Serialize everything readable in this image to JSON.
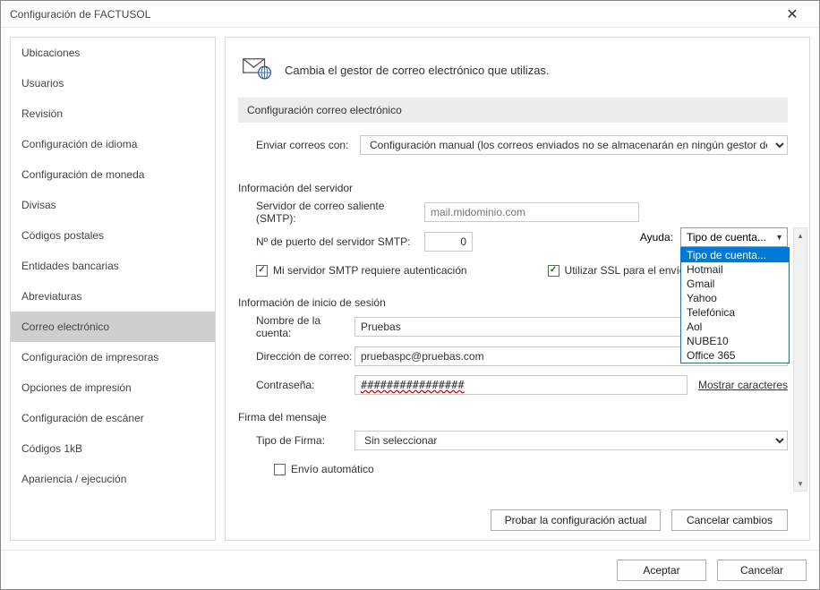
{
  "window": {
    "title": "Configuración de FACTUSOL"
  },
  "sidebar": {
    "items": [
      {
        "label": "Ubicaciones"
      },
      {
        "label": "Usuarios"
      },
      {
        "label": "Revisión"
      },
      {
        "label": "Configuración de idioma"
      },
      {
        "label": "Configuración de moneda"
      },
      {
        "label": "Divisas"
      },
      {
        "label": "Códigos postales"
      },
      {
        "label": "Entidades bancarias"
      },
      {
        "label": "Abreviaturas"
      },
      {
        "label": "Correo electrónico",
        "selected": true
      },
      {
        "label": "Configuración de impresoras"
      },
      {
        "label": "Opciones de impresión"
      },
      {
        "label": "Configuración de escáner"
      },
      {
        "label": "Códigos 1kB"
      },
      {
        "label": "Apariencia / ejecución"
      }
    ]
  },
  "main": {
    "heading": "Cambia el gestor de correo electrónico que utilizas.",
    "section_title": "Configuración correo electrónico",
    "send_with_label": "Enviar correos con:",
    "send_with_value": "Configuración manual (los correos enviados no se almacenarán en ningún gestor de correo)",
    "server_info_heading": "Información del servidor",
    "help_label": "Ayuda:",
    "account_type_label": "Tipo de cuenta...",
    "account_type_options": [
      "Tipo de cuenta...",
      "Hotmail",
      "Gmail",
      "Yahoo",
      "Telefónica",
      "Aol",
      "NUBE10",
      "Office 365"
    ],
    "smtp_server_label": "Servidor de correo saliente (SMTP):",
    "smtp_server_placeholder": "mail.midominio.com",
    "smtp_port_label": "Nº de puerto del servidor SMTP:",
    "smtp_port_value": "0",
    "smtp_auth_label": "Mi servidor SMTP requiere autenticación",
    "use_ssl_label": "Utilizar SSL para el envío de",
    "login_info_heading": "Información de inicio de sesión",
    "account_name_label": "Nombre de la cuenta:",
    "account_name_value": "Pruebas",
    "email_label": "Dirección de correo:",
    "email_value": "pruebaspc@pruebas.com",
    "password_label": "Contraseña:",
    "password_value": "################",
    "show_chars": "Mostrar caracteres",
    "signature_heading": "Firma del mensaje",
    "signature_type_label": "Tipo de Firma:",
    "signature_type_value": "Sin seleccionar",
    "auto_send_label": "Envío automático",
    "test_button": "Probar la configuración actual",
    "cancel_changes": "Cancelar cambios"
  },
  "dialog": {
    "accept": "Aceptar",
    "cancel": "Cancelar"
  }
}
